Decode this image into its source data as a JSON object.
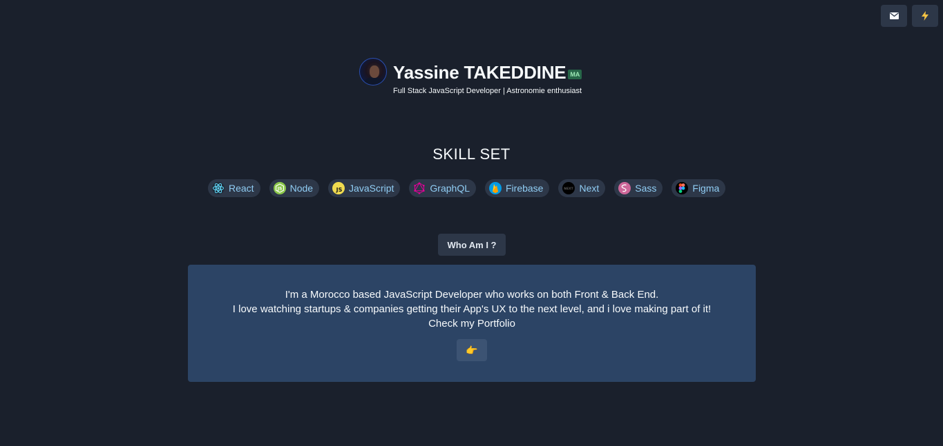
{
  "topbar": {
    "mail_icon": "envelope-icon",
    "theme_icon": "lightning-icon"
  },
  "profile": {
    "name": "Yassine TAKEDDINE",
    "country_badge": "MA",
    "subtitle": "Full Stack JavaScript Developer | Astronomie enthusiast"
  },
  "skills": {
    "title": "SKILL SET",
    "items": [
      {
        "label": "React",
        "icon": "react-icon"
      },
      {
        "label": "Node",
        "icon": "node-icon"
      },
      {
        "label": "JavaScript",
        "icon": "javascript-icon"
      },
      {
        "label": "GraphQL",
        "icon": "graphql-icon"
      },
      {
        "label": "Firebase",
        "icon": "firebase-icon"
      },
      {
        "label": "Next",
        "icon": "next-icon"
      },
      {
        "label": "Sass",
        "icon": "sass-icon"
      },
      {
        "label": "Figma",
        "icon": "figma-icon"
      }
    ]
  },
  "about": {
    "button_label": "Who Am I ?",
    "lines": [
      "I'm a Morocco based JavaScript Developer who works on both Front & Back End.",
      "I love watching startups & companies getting their App's UX to the next level, and i love making part of it!",
      "Check my Portfolio"
    ],
    "portfolio_button_icon": "👉"
  },
  "colors": {
    "background": "#1a202c",
    "card": "#2c4465",
    "chip_text": "#90cdf4",
    "badge_bg": "#276749"
  }
}
